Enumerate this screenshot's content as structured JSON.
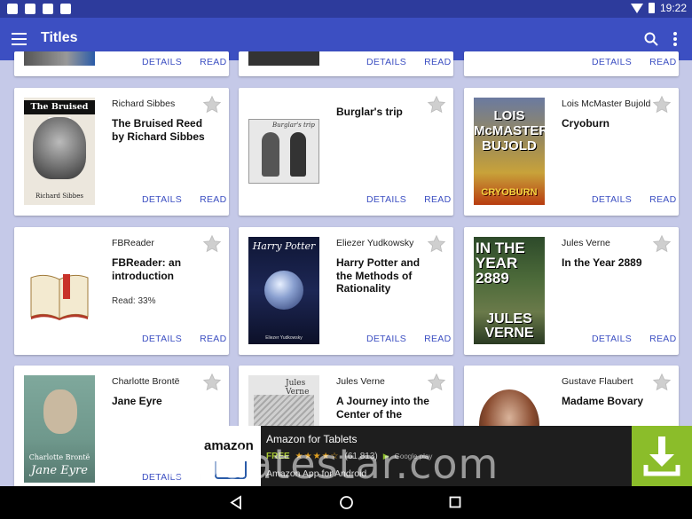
{
  "status_bar": {
    "time": "19:22"
  },
  "app_bar": {
    "title": "Titles"
  },
  "actions": {
    "details": "DETAILS",
    "read": "READ"
  },
  "cards": [
    {
      "author": "",
      "title": ""
    },
    {
      "author": "",
      "title": ""
    },
    {
      "author": "",
      "title": ""
    },
    {
      "author": "Richard Sibbes",
      "title": "The Bruised Reed by Richard Sibbes",
      "cover_text": "The Bruised Reed",
      "cover_sub": "Richard Sibbes"
    },
    {
      "author": "",
      "title": "Burglar's trip",
      "cover_text": "Burglar's trip"
    },
    {
      "author": "Lois McMaster Bujold",
      "title": "Cryoburn",
      "cover_text": "LOIS McMASTER BUJOLD",
      "cover_sub": "CRYOBURN"
    },
    {
      "author": "FBReader",
      "title": "FBReader: an introduction",
      "progress": "Read: 33%"
    },
    {
      "author": "Eliezer Yudkowsky",
      "title": "Harry Potter and the Methods of Rationality",
      "cover_text": "Harry Potter",
      "cover_sub": "Eliezer Yudkowsky"
    },
    {
      "author": "Jules Verne",
      "title": "In the Year 2889",
      "cover_text": "IN THE YEAR 2889",
      "cover_sub": "JULES VERNE"
    },
    {
      "author": "Charlotte Brontë",
      "title": "Jane Eyre",
      "cover_text": "Charlotte Brontë",
      "cover_sub": "Jane Eyre"
    },
    {
      "author": "Jules Verne",
      "title": "A Journey into the Center of the",
      "cover_text": "Jules Verne"
    },
    {
      "author": "Gustave Flaubert",
      "title": "Madame Bovary"
    }
  ],
  "ad": {
    "logo_text": "amazon",
    "title": "Amazon for Tablets",
    "price": "FREE",
    "stars": "★★★★☆",
    "rating_count": "(61,813)",
    "store": "Google play",
    "subtitle": "Amazon App for Android"
  },
  "watermark": "Updatestar.com",
  "colors": {
    "app_bar": "#3c4fc2",
    "status_bar": "#2d3b9c",
    "accent": "#3c4fc2",
    "background": "#c5c9e8",
    "download": "#8bbd2a"
  }
}
